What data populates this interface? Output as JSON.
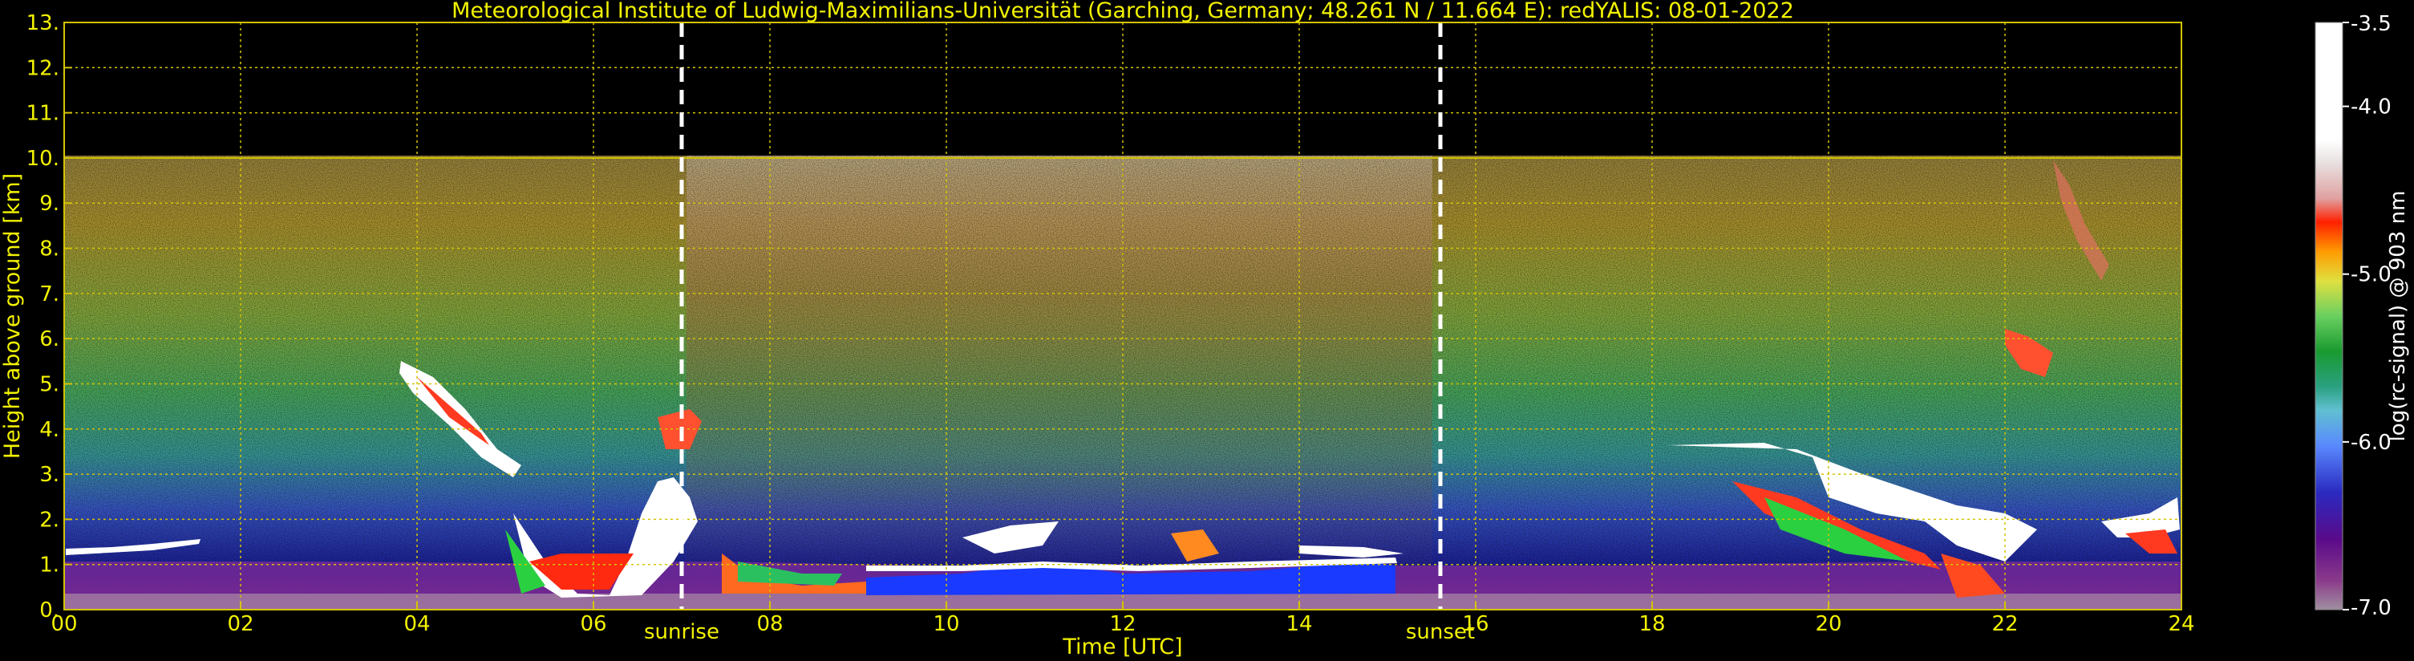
{
  "chart_data": {
    "type": "heatmap",
    "title": "Meteorological Institute of Ludwig-Maximilians-Universität (Garching, Germany; 48.261 N / 11.664 E):    redYALIS: 08-01-2022",
    "xlabel": "Time [UTC]",
    "ylabel": "Height above ground [km]",
    "xlim": [
      0,
      24
    ],
    "ylim": [
      0,
      13
    ],
    "x_tick_labels": [
      "00",
      "02",
      "04",
      "06",
      "08",
      "10",
      "12",
      "14",
      "16",
      "18",
      "20",
      "22",
      "24"
    ],
    "x_tick_values": [
      0,
      2,
      4,
      6,
      8,
      10,
      12,
      14,
      16,
      18,
      20,
      22,
      24
    ],
    "y_tick_labels": [
      "0.",
      "1.",
      "2.",
      "3.",
      "4.",
      "5.",
      "6.",
      "7.",
      "8.",
      "9.",
      "10.",
      "11.",
      "12.",
      "13."
    ],
    "y_tick_values": [
      0,
      1,
      2,
      3,
      4,
      5,
      6,
      7,
      8,
      9,
      10,
      11,
      12,
      13
    ],
    "grid": true,
    "data_top_km": 10,
    "event_markers": [
      {
        "label": "sunrise",
        "time": 7.0
      },
      {
        "label": "sunset",
        "time": 15.6
      }
    ],
    "colorbar": {
      "label": "log(rc-signal) @ 903 nm",
      "range": [
        -7.0,
        -3.5
      ],
      "tick_labels": [
        "-3.5",
        "-4.0",
        "-5.0",
        "-6.0",
        "-7.0"
      ],
      "tick_values": [
        -3.5,
        -4.0,
        -5.0,
        -6.0,
        -7.0
      ]
    },
    "colors": {
      "axis_text": "#f2f200",
      "grid": "#d4c400",
      "background": "#000000",
      "marker_line": "#ffffff"
    }
  }
}
